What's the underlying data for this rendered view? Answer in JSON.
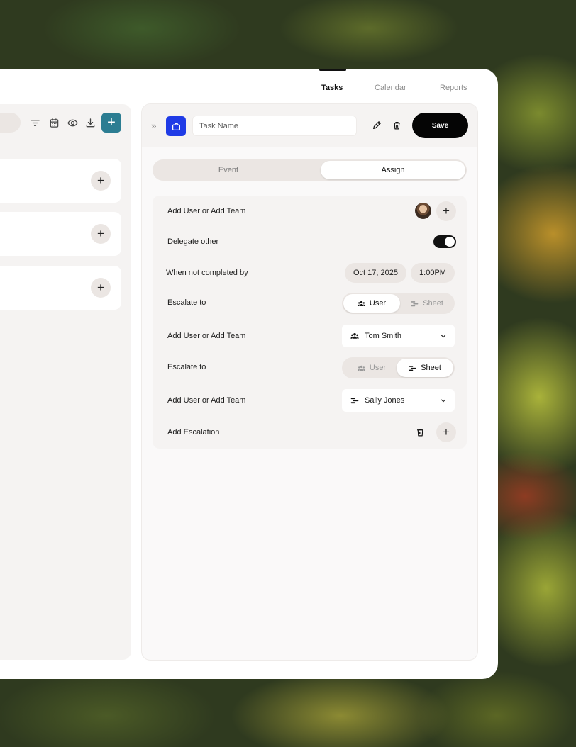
{
  "nav": {
    "tabs": [
      {
        "label": "Tasks",
        "active": true
      },
      {
        "label": "Calendar",
        "active": false
      },
      {
        "label": "Reports",
        "active": false
      }
    ]
  },
  "left_toolbar": {
    "icons": [
      "filter-icon",
      "calendar-icon",
      "eye-icon",
      "download-icon"
    ],
    "add_label": "+"
  },
  "left_cards": [
    {
      "action": "+"
    },
    {
      "action": "+"
    },
    {
      "action": "+"
    }
  ],
  "header": {
    "task_name_placeholder": "Task Name",
    "task_name_value": "",
    "save_label": "Save",
    "accent_color": "#1f3be6"
  },
  "tabs": {
    "event": "Event",
    "assign": "Assign",
    "active": "Assign"
  },
  "form": {
    "add_user_1": "Add User or Add Team",
    "delegate": "Delegate other",
    "delegate_on": true,
    "when_not_completed": "When not completed by",
    "date": "Oct 17, 2025",
    "time": "1:00PM",
    "escalate_1": {
      "label": "Escalate to",
      "user": "User",
      "sheet": "Sheet",
      "selected": "User"
    },
    "add_user_2": {
      "label": "Add User or Add Team",
      "value": "Tom Smith"
    },
    "escalate_2": {
      "label": "Escalate to",
      "user": "User",
      "sheet": "Sheet",
      "selected": "Sheet"
    },
    "add_user_3": {
      "label": "Add User or Add Team",
      "value": "Sally Jones"
    },
    "add_escalation": "Add Escalation"
  }
}
